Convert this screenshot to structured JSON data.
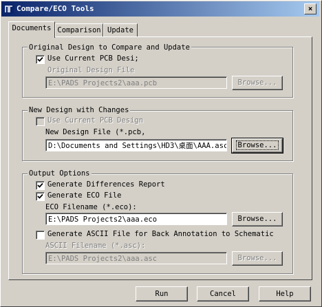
{
  "window": {
    "title": "Compare/ECO Tools",
    "close_glyph": "×"
  },
  "tabs": [
    {
      "label": "Documents"
    },
    {
      "label": "Comparison"
    },
    {
      "label": "Update"
    }
  ],
  "original_design": {
    "group_title": "Original Design to Compare and Update",
    "use_current_label": "Use Current PCB Desi;",
    "use_current_checked": true,
    "file_label": "Original Design File",
    "file_value": "E:\\PADS Projects2\\aaa.pcb",
    "browse_label": "Browse..."
  },
  "new_design": {
    "group_title": "New Design with Changes",
    "use_current_label": "Use Current PCB Design",
    "use_current_checked": false,
    "file_label": "New Design File (*.pcb,",
    "file_value": "D:\\Documents and Settings\\HD3\\桌面\\AAA.asc",
    "browse_label": "Browse..."
  },
  "output_options": {
    "group_title": "Output Options",
    "diff_report_label": "Generate Differences Report",
    "diff_report_checked": true,
    "eco_file_label": "Generate ECO File",
    "eco_file_checked": true,
    "eco_filename_label": "ECO Filename (*.eco):",
    "eco_filename_value": "E:\\PADS Projects2\\aaa.eco",
    "eco_browse_label": "Browse...",
    "ascii_label": "Generate ASCII File for Back Annotation to Schematic",
    "ascii_checked": false,
    "ascii_filename_label": "ASCII Filename (*.asc):",
    "ascii_filename_value": "E:\\PADS Projects2\\aaa.asc",
    "ascii_browse_label": "Browse..."
  },
  "footer": {
    "run_label": "Run",
    "cancel_label": "Cancel",
    "help_label": "Help"
  }
}
